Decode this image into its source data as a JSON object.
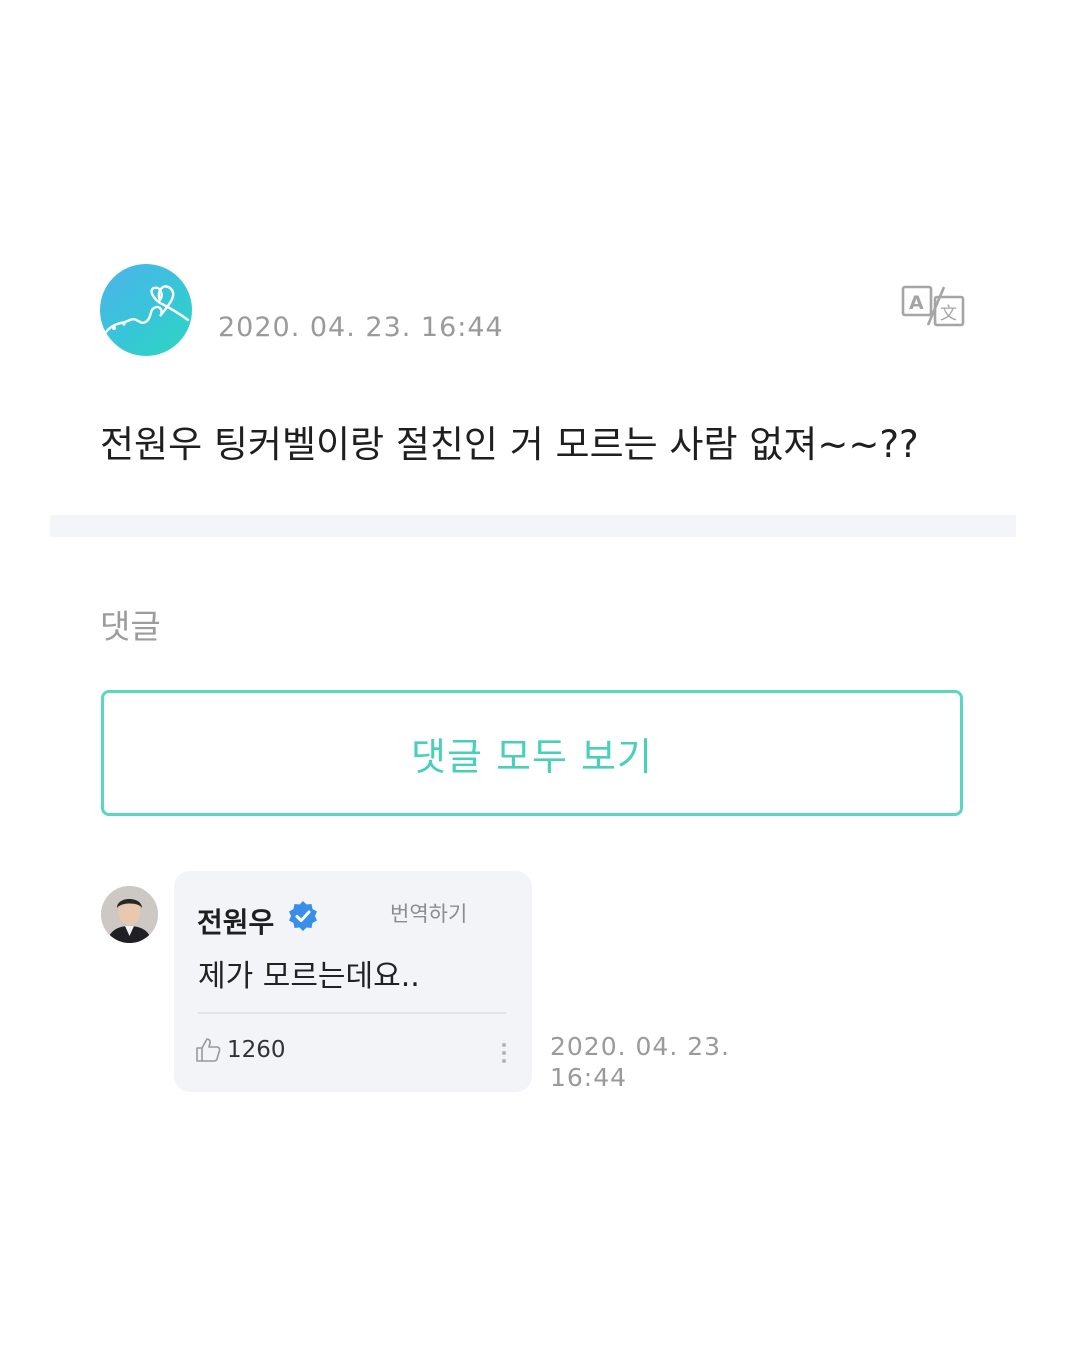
{
  "post": {
    "timestamp": "2020. 04. 23. 16:44",
    "text": "전원우 팅커벨이랑 절친인 거 모르는 사람 없져~~??",
    "avatar_icon": "heart-doodle-icon",
    "translate_icon": "translate-icon"
  },
  "comments_section": {
    "heading": "댓글",
    "view_all_label": "댓글 모두 보기"
  },
  "comment": {
    "author": "전원우",
    "verified_icon": "verified-badge-icon",
    "translate_label": "번역하기",
    "text": "제가 모르는데요..",
    "like_count": "1260",
    "timestamp_date": "2020. 04. 23.",
    "timestamp_time": "16:44"
  },
  "colors": {
    "accent": "#48d0bb",
    "verified": "#3b8ee8",
    "muted_text": "#9a9a9a"
  }
}
